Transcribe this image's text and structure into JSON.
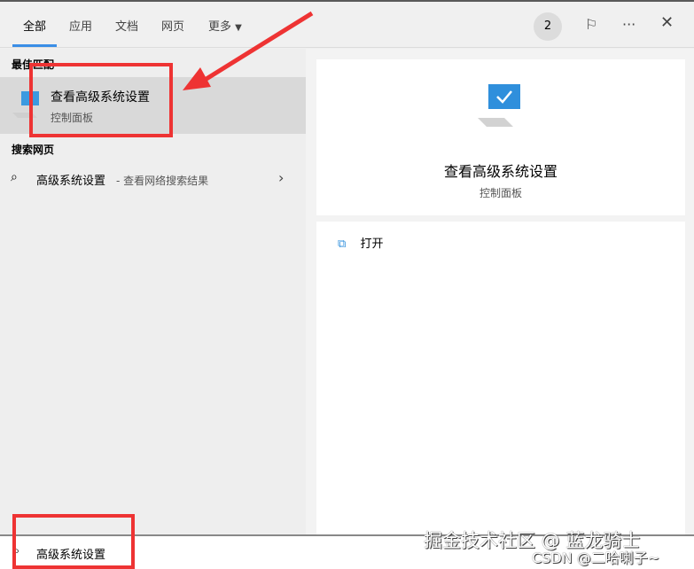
{
  "tabs": {
    "all": "全部",
    "apps": "应用",
    "docs": "文档",
    "web": "网页",
    "more": "更多"
  },
  "header": {
    "badge_count": "2"
  },
  "left": {
    "best_match_heading": "最佳匹配",
    "best_match": {
      "title": "查看高级系统设置",
      "subtitle": "控制面板"
    },
    "web_heading": "搜索网页",
    "web_result": {
      "query": "高级系统设置",
      "hint": " - 查看网络搜索结果"
    }
  },
  "right": {
    "title": "查看高级系统设置",
    "subtitle": "控制面板",
    "actions": [
      {
        "label": "打开"
      }
    ]
  },
  "search": {
    "value": "高级系统设置"
  },
  "watermark": {
    "line1": "掘金技术社区 @ 蓝龙骑士",
    "line2": "CSDN @二哈喇子~"
  },
  "colors": {
    "accent": "#3a8ee6",
    "annotation": "#ee3333"
  }
}
